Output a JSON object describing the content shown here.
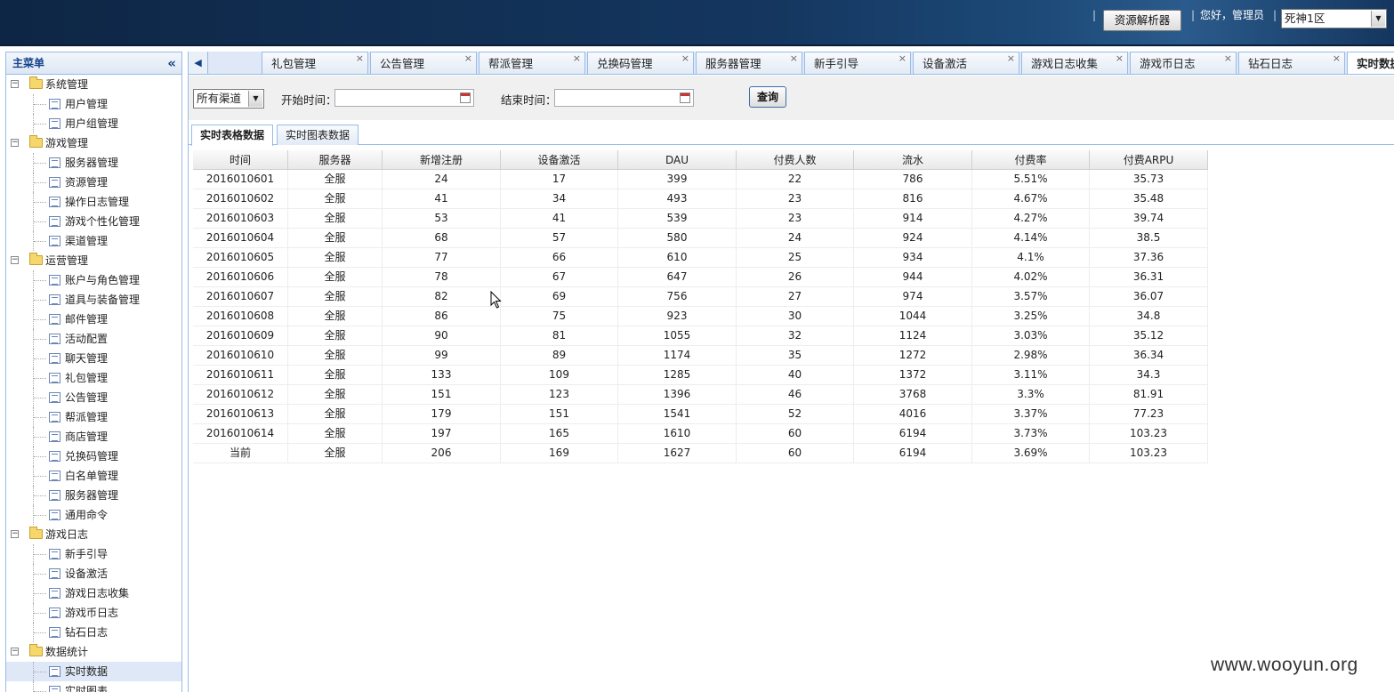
{
  "header": {
    "resource_button": "资源解析器",
    "greeting": "您好，管理员",
    "server_selected": "死神1区"
  },
  "sidebar": {
    "title": "主菜单",
    "groups": [
      {
        "label": "系统管理",
        "items": [
          "用户管理",
          "用户组管理"
        ]
      },
      {
        "label": "游戏管理",
        "items": [
          "服务器管理",
          "资源管理",
          "操作日志管理",
          "游戏个性化管理",
          "渠道管理"
        ]
      },
      {
        "label": "运营管理",
        "items": [
          "账户与角色管理",
          "道具与装备管理",
          "邮件管理",
          "活动配置",
          "聊天管理",
          "礼包管理",
          "公告管理",
          "帮派管理",
          "商店管理",
          "兑换码管理",
          "白名单管理",
          "服务器管理",
          "通用命令"
        ]
      },
      {
        "label": "游戏日志",
        "items": [
          "新手引导",
          "设备激活",
          "游戏日志收集",
          "游戏币日志",
          "钻石日志"
        ]
      },
      {
        "label": "数据统计",
        "items": [
          "实时数据",
          "实时图表"
        ]
      }
    ],
    "selected": "实时数据"
  },
  "tabs": {
    "partial": "",
    "items": [
      "礼包管理",
      "公告管理",
      "帮派管理",
      "兑换码管理",
      "服务器管理",
      "新手引导",
      "设备激活",
      "游戏日志收集",
      "游戏币日志",
      "钻石日志"
    ],
    "active": "实时数据"
  },
  "filter": {
    "channel": "所有渠道",
    "start_label": "开始时间：",
    "end_label": "结束时间：",
    "start_value": "",
    "end_value": "",
    "query_button": "查询"
  },
  "subtabs": [
    "实时表格数据",
    "实时图表数据"
  ],
  "grid": {
    "columns": [
      "时间",
      "服务器",
      "新增注册",
      "设备激活",
      "DAU",
      "付费人数",
      "流水",
      "付费率",
      "付费ARPU"
    ],
    "rows": [
      [
        "2016010601",
        "全服",
        "24",
        "17",
        "399",
        "22",
        "786",
        "5.51%",
        "35.73"
      ],
      [
        "2016010602",
        "全服",
        "41",
        "34",
        "493",
        "23",
        "816",
        "4.67%",
        "35.48"
      ],
      [
        "2016010603",
        "全服",
        "53",
        "41",
        "539",
        "23",
        "914",
        "4.27%",
        "39.74"
      ],
      [
        "2016010604",
        "全服",
        "68",
        "57",
        "580",
        "24",
        "924",
        "4.14%",
        "38.5"
      ],
      [
        "2016010605",
        "全服",
        "77",
        "66",
        "610",
        "25",
        "934",
        "4.1%",
        "37.36"
      ],
      [
        "2016010606",
        "全服",
        "78",
        "67",
        "647",
        "26",
        "944",
        "4.02%",
        "36.31"
      ],
      [
        "2016010607",
        "全服",
        "82",
        "69",
        "756",
        "27",
        "974",
        "3.57%",
        "36.07"
      ],
      [
        "2016010608",
        "全服",
        "86",
        "75",
        "923",
        "30",
        "1044",
        "3.25%",
        "34.8"
      ],
      [
        "2016010609",
        "全服",
        "90",
        "81",
        "1055",
        "32",
        "1124",
        "3.03%",
        "35.12"
      ],
      [
        "2016010610",
        "全服",
        "99",
        "89",
        "1174",
        "35",
        "1272",
        "2.98%",
        "36.34"
      ],
      [
        "2016010611",
        "全服",
        "133",
        "109",
        "1285",
        "40",
        "1372",
        "3.11%",
        "34.3"
      ],
      [
        "2016010612",
        "全服",
        "151",
        "123",
        "1396",
        "46",
        "3768",
        "3.3%",
        "81.91"
      ],
      [
        "2016010613",
        "全服",
        "179",
        "151",
        "1541",
        "52",
        "4016",
        "3.37%",
        "77.23"
      ],
      [
        "2016010614",
        "全服",
        "197",
        "165",
        "1610",
        "60",
        "6194",
        "3.73%",
        "103.23"
      ],
      [
        "当前",
        "全服",
        "206",
        "169",
        "1627",
        "60",
        "6194",
        "3.69%",
        "103.23"
      ]
    ]
  },
  "watermark": "www.wooyun.org",
  "icons": {
    "close": "close-icon",
    "collapse": "double-chevron-left-icon",
    "folder": "folder-icon",
    "document": "document-icon",
    "calendar": "calendar-icon"
  }
}
